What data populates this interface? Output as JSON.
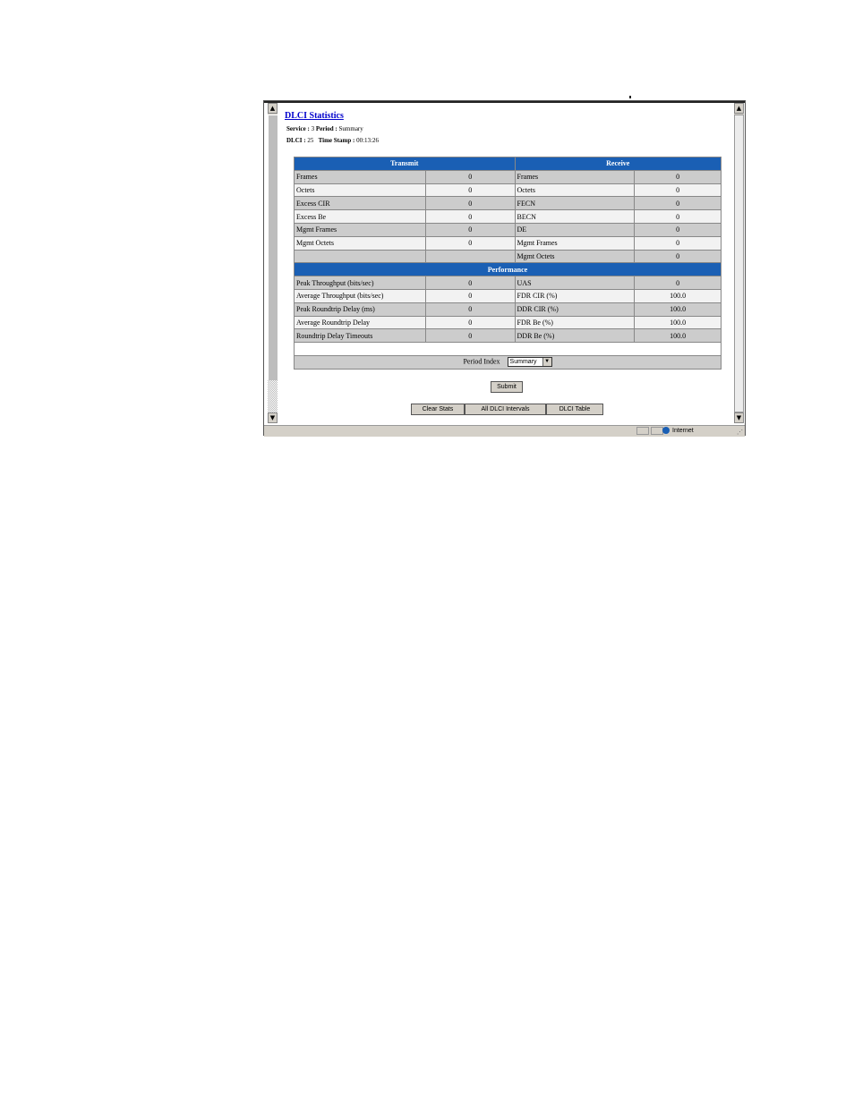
{
  "page": {
    "title": "DLCI Statistics",
    "meta1": {
      "service_label": "Service :",
      "service_value": "3",
      "period_label": "Period :",
      "period_value": "Summary"
    },
    "meta2": {
      "dlci_label": "DLCI :",
      "dlci_value": "25",
      "timestamp_label": "Time Stamp :",
      "timestamp_value": "00:13:26"
    }
  },
  "table": {
    "transmit_header": "Transmit",
    "receive_header": "Receive",
    "rows": [
      {
        "tx_label": "Frames",
        "tx_value": "0",
        "rx_label": "Frames",
        "rx_value": "0"
      },
      {
        "tx_label": "Octets",
        "tx_value": "0",
        "rx_label": "Octets",
        "rx_value": "0"
      },
      {
        "tx_label": "Excess CIR",
        "tx_value": "0",
        "rx_label": "FECN",
        "rx_value": "0"
      },
      {
        "tx_label": "Excess Be",
        "tx_value": "0",
        "rx_label": "BECN",
        "rx_value": "0"
      },
      {
        "tx_label": "Mgmt Frames",
        "tx_value": "0",
        "rx_label": "DE",
        "rx_value": "0"
      },
      {
        "tx_label": "Mgmt Octets",
        "tx_value": "0",
        "rx_label": "Mgmt Frames",
        "rx_value": "0"
      },
      {
        "tx_label": "",
        "tx_value": "",
        "rx_label": "Mgmt Octets",
        "rx_value": "0"
      }
    ],
    "performance_header": "Performance",
    "perf_rows": [
      {
        "l_label": "Peak Throughput (bits/sec)",
        "l_value": "0",
        "r_label": "UAS",
        "r_value": "0"
      },
      {
        "l_label": "Average Throughput (bits/sec)",
        "l_value": "0",
        "r_label": "FDR CIR (%)",
        "r_value": "100.0"
      },
      {
        "l_label": "Peak Roundtrip  Delay (ms)",
        "l_value": "0",
        "r_label": "DDR CIR (%)",
        "r_value": "100.0"
      },
      {
        "l_label": "Average Roundtrip Delay",
        "l_value": "0",
        "r_label": "FDR Be (%)",
        "r_value": "100.0"
      },
      {
        "l_label": "Roundtrip Delay Timeouts",
        "l_value": "0",
        "r_label": "DDR Be (%)",
        "r_value": "100.0"
      }
    ],
    "period_index_label": "Period Index",
    "period_index_value": "Summary"
  },
  "buttons": {
    "submit": "Submit",
    "clear_stats": "Clear Stats",
    "all_intervals": "All DLCI Intervals",
    "dlci_table": "DLCI Table"
  },
  "status_bar": {
    "zone": "Internet"
  },
  "icons": {
    "scroll_up": "up-arrow-icon",
    "scroll_down": "down-arrow-icon",
    "globe": "globe-icon"
  },
  "colors": {
    "header_blue": "#1a5fb4",
    "row_gray": "#cccccc",
    "link_blue": "#0000cc"
  }
}
